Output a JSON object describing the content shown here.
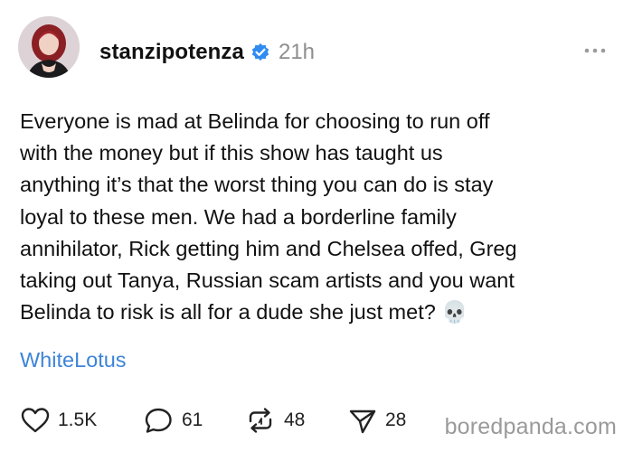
{
  "post": {
    "username": "stanzipotenza",
    "timestamp": "21h",
    "body": "Everyone is mad at Belinda for choosing to run off\nwith the money but if this show has taught us\nanything it’s that the worst thing you can do is stay\nloyal to these men. We had a borderline family\nannihilator, Rick getting him and Chelsea offed, Greg\ntaking out Tanya, Russian scam artists and you want\nBelinda to risk is all for a dude she just met? 💀",
    "hashtag": "WhiteLotus"
  },
  "actions": {
    "likes": "1.5K",
    "comments": "61",
    "reposts": "48",
    "shares": "28"
  },
  "icons": {
    "verified": "verified-badge-icon",
    "more": "more-options-icon",
    "like": "heart-icon",
    "comment": "comment-bubble-icon",
    "repost": "repost-icon",
    "share": "send-icon"
  },
  "colors": {
    "hashtag": "#3d84d9",
    "verified": "#2f8bf0",
    "timestamp": "#8e8e8e"
  },
  "watermark": "boredpanda.com"
}
